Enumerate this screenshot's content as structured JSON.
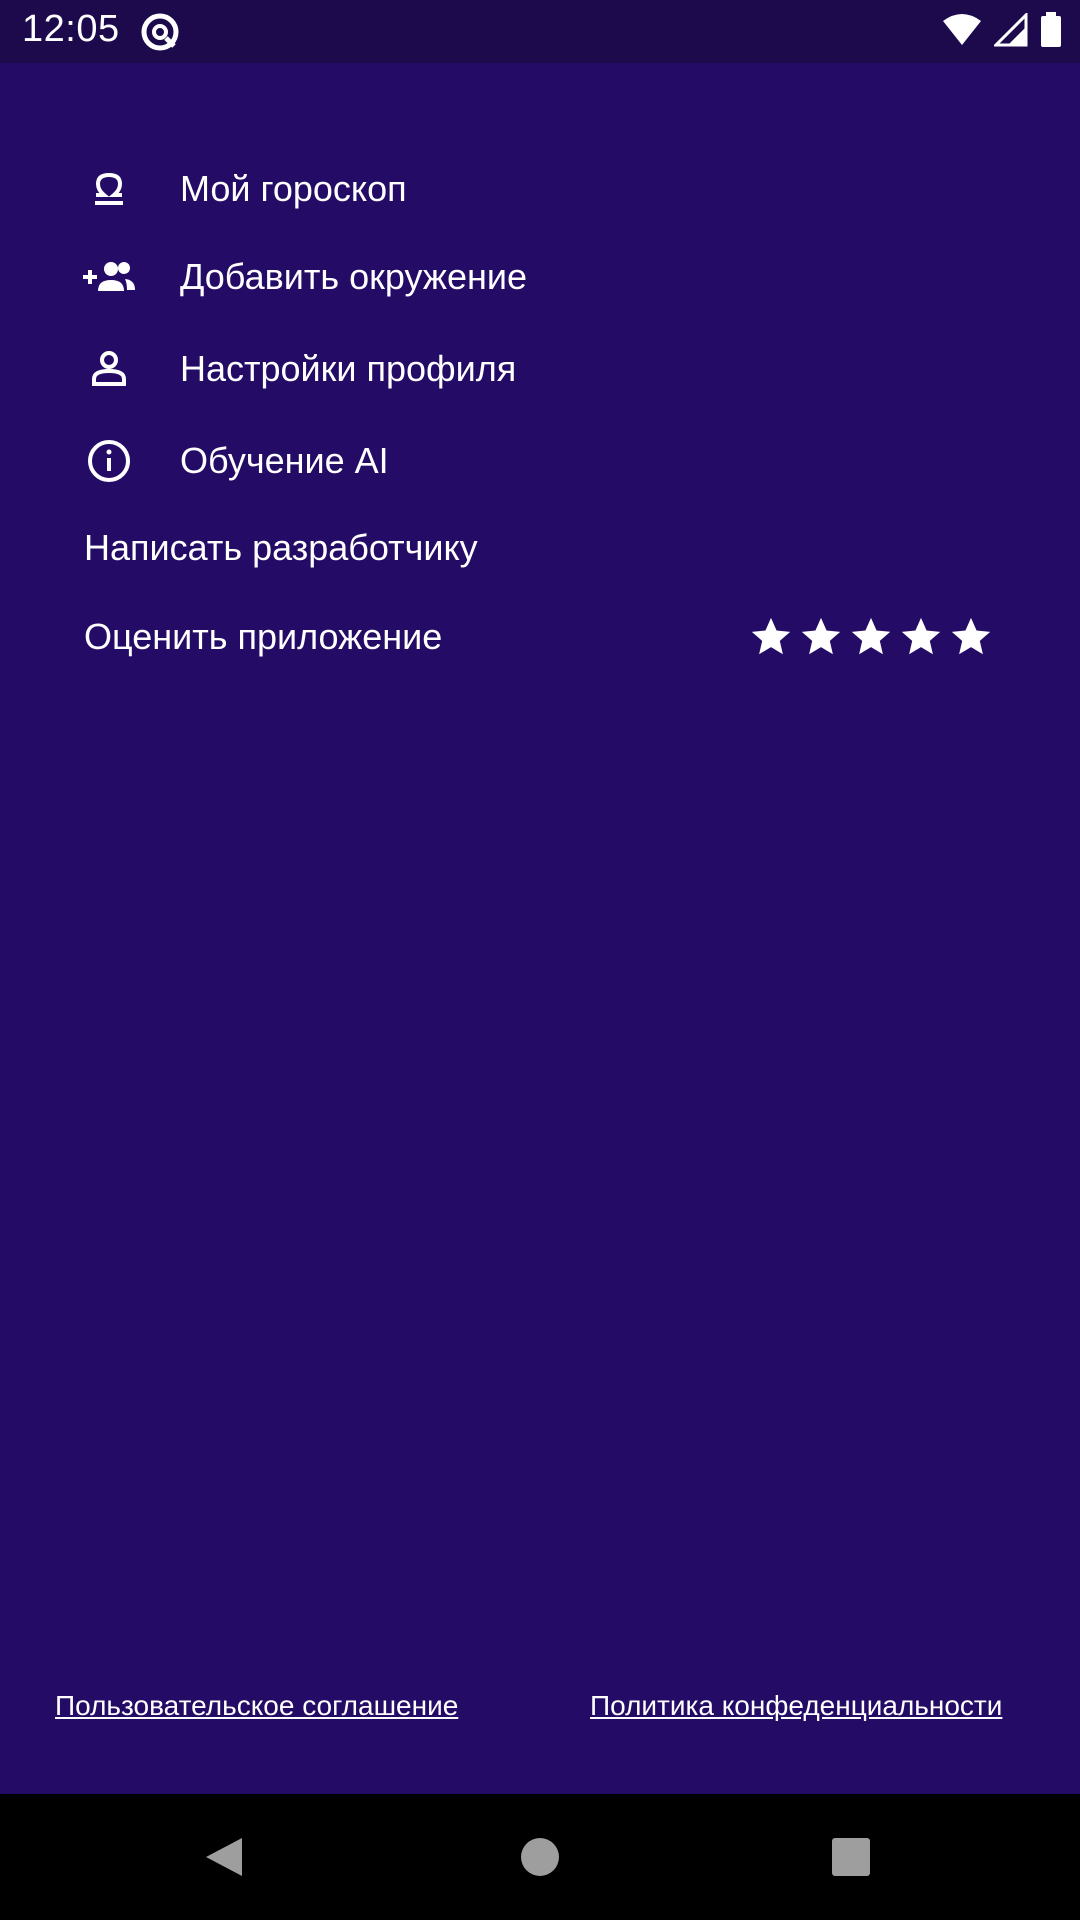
{
  "status_bar": {
    "time": "12:05",
    "app_icon": "at-sign-icon",
    "icons": [
      "wifi-icon",
      "signal-icon",
      "battery-icon"
    ]
  },
  "menu": {
    "items": [
      {
        "label": "Мой гороскоп",
        "icon": "libra-icon"
      },
      {
        "label": "Добавить окружение",
        "icon": "add-group-icon"
      },
      {
        "label": "Настройки профиля",
        "icon": "person-icon"
      },
      {
        "label": "Обучение AI",
        "icon": "info-icon"
      },
      {
        "label": "Написать разработчику"
      },
      {
        "label": "Оценить приложение"
      }
    ],
    "rating": {
      "stars": 5,
      "filled": 5
    }
  },
  "footer": {
    "terms": "Пользовательское соглашение",
    "privacy": "Политика конфеденциальности"
  },
  "colors": {
    "background": "#240c66",
    "status_bar": "#1c0a4d",
    "nav_bar": "#000000",
    "text": "#ffffff"
  }
}
